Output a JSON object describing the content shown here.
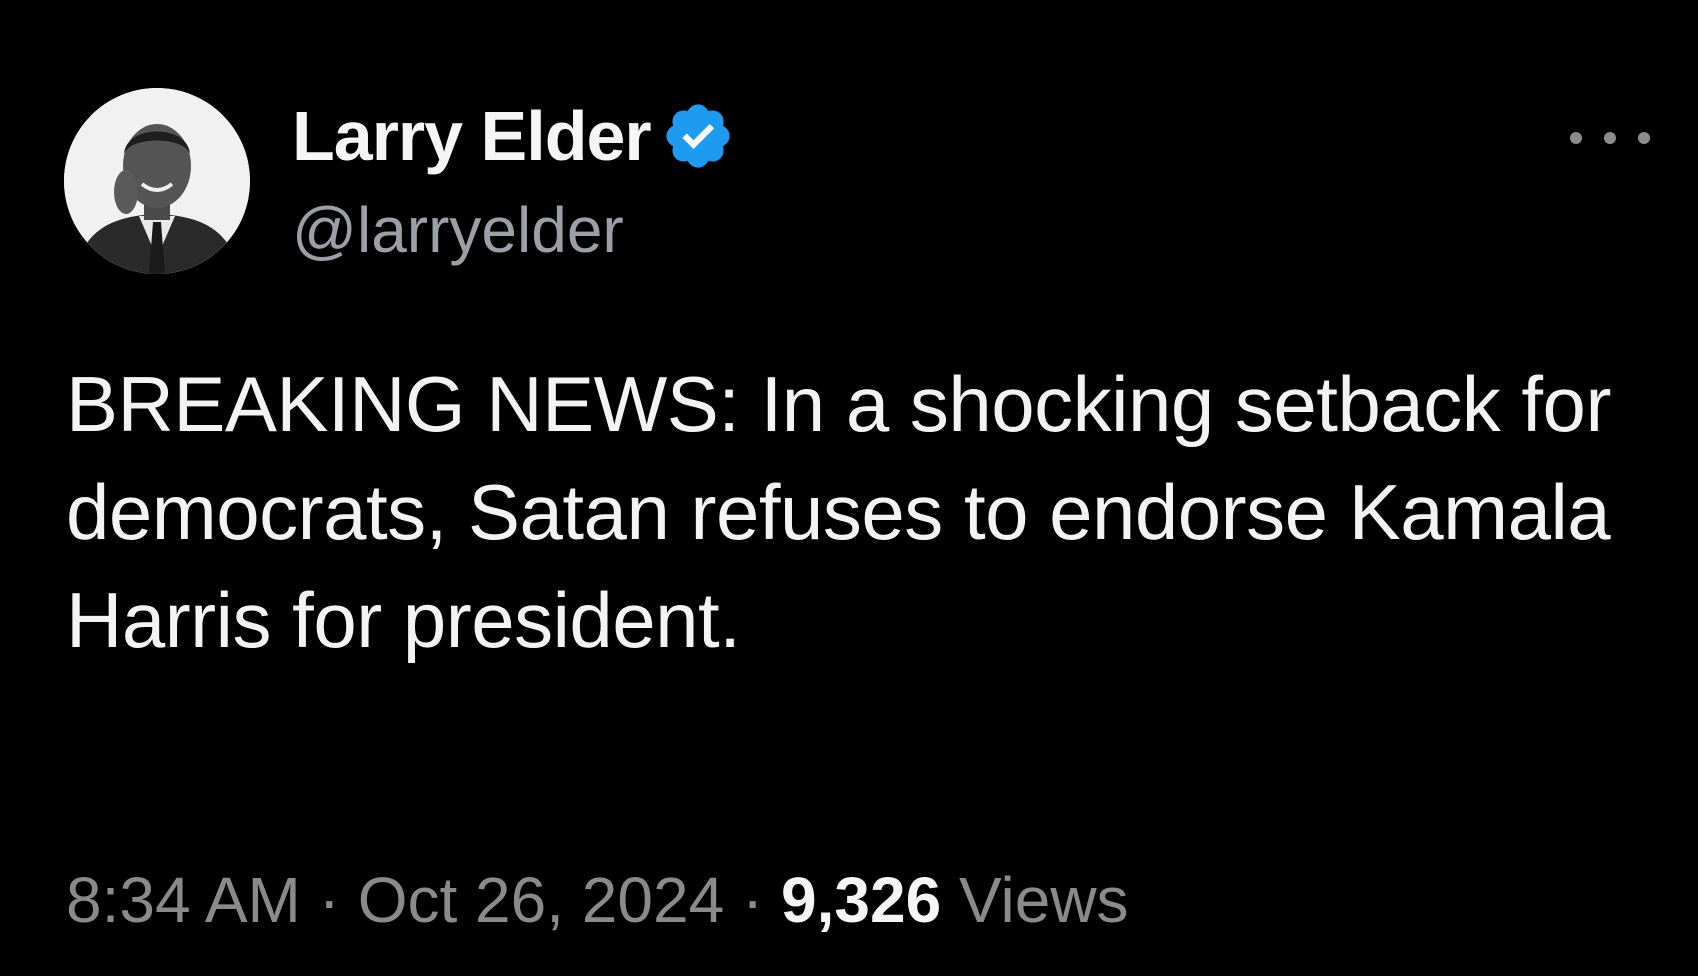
{
  "tweet": {
    "author": {
      "display_name": "Larry Elder",
      "handle": "@larryelder",
      "verified_icon": "verified-badge-icon",
      "avatar_icon": "avatar"
    },
    "text": "BREAKING NEWS: In a shocking setback for democrats, Satan refuses to endorse Kamala Harris for president.",
    "time": "8:34 AM",
    "separator": "·",
    "date": "Oct 26, 2024",
    "views_count": "9,326",
    "views_label": "Views",
    "more_icon": "more-options-icon"
  },
  "colors": {
    "background": "#000000",
    "text": "#f3f3f3",
    "secondary_text": "#8a8a8a",
    "verified_blue": "#1d9bf0"
  }
}
